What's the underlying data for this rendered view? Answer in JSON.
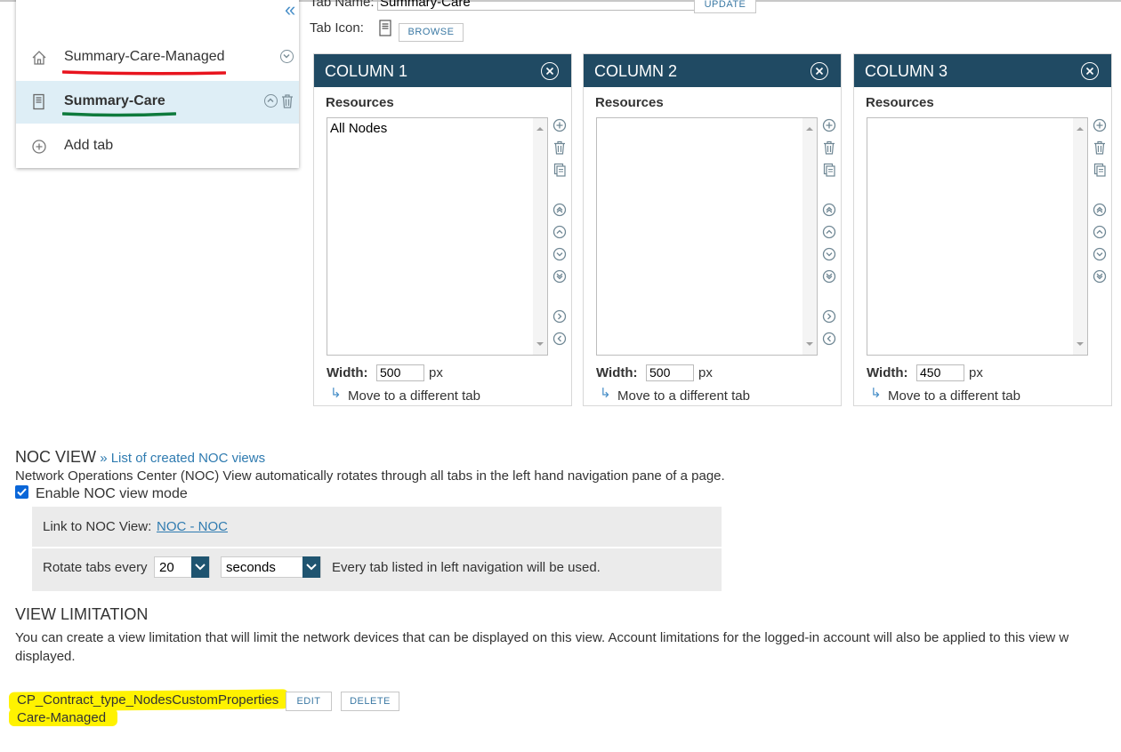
{
  "tab_nav": {
    "items": [
      {
        "label": "Summary-Care-Managed",
        "icon": "home-icon",
        "active": false
      },
      {
        "label": "Summary-Care",
        "icon": "document-icon",
        "active": true
      }
    ],
    "add_tab_label": "Add tab"
  },
  "tab_editor": {
    "name_label": "Tab Name:",
    "name_value": "Summary-Care",
    "update_button": "UPDATE",
    "icon_label": "Tab Icon:",
    "browse_button": "BROWSE"
  },
  "columns": [
    {
      "title": "COLUMN 1",
      "resources_label": "Resources",
      "items": [
        "All Nodes"
      ],
      "width_label": "Width:",
      "width_value": "500",
      "unit": "px",
      "move_label": "Move to a different tab"
    },
    {
      "title": "COLUMN 2",
      "resources_label": "Resources",
      "items": [],
      "width_label": "Width:",
      "width_value": "500",
      "unit": "px",
      "move_label": "Move to a different tab"
    },
    {
      "title": "COLUMN 3",
      "resources_label": "Resources",
      "items": [],
      "width_label": "Width:",
      "width_value": "450",
      "unit": "px",
      "move_label": "Move to a different tab"
    }
  ],
  "noc": {
    "heading": "NOC VIEW",
    "list_link": "» List of created NOC views",
    "description": "Network Operations Center (NOC) View automatically rotates through all tabs in the left hand navigation pane of a page.",
    "enable_label": "Enable NOC view mode",
    "enabled": true,
    "link_label": "Link to NOC View:",
    "link_value": "NOC - NOC",
    "rotate_label": "Rotate tabs every",
    "rotate_value": "20",
    "rotate_unit": "seconds",
    "rotate_note": "Every tab listed in left navigation will be used."
  },
  "view_limitation": {
    "heading": "VIEW LIMITATION",
    "description_line1": "You can create a view limitation that will limit the network devices that can be displayed on this view. Account limitations for the logged-in account will also be applied to this view w",
    "description_line2": "displayed.",
    "limitation_name": "CP_Contract_type_NodesCustomProperties",
    "limitation_value": "Care-Managed",
    "edit_button": "EDIT",
    "delete_button": "DELETE"
  },
  "colors": {
    "column_header": "#204a63",
    "link": "#2f7bb0",
    "active_tab_bg": "#deeef6",
    "annotation_red": "#e8141e",
    "annotation_green": "#0e7a3c",
    "highlight": "#fff200"
  }
}
